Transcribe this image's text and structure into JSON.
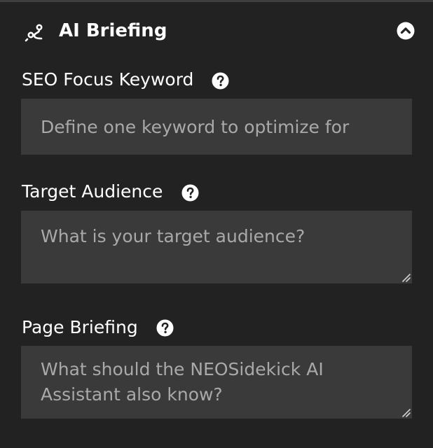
{
  "section": {
    "title": "AI Briefing",
    "icon": "ai-briefing-icon",
    "toggle_icon": "chevron-up-circle-icon"
  },
  "fields": {
    "seo_keyword": {
      "label": "SEO Focus Keyword",
      "value": "",
      "placeholder": "Define one keyword to optimize for",
      "help_icon": "question-circle-icon"
    },
    "target_audience": {
      "label": "Target Audience",
      "value": "",
      "placeholder": "What is your target audience?",
      "help_icon": "question-circle-icon"
    },
    "page_briefing": {
      "label": "Page Briefing",
      "value": "",
      "placeholder": "What should the NEOSidekick AI Assistant also know?",
      "help_icon": "question-circle-icon"
    }
  },
  "colors": {
    "background": "#222222",
    "input_background": "#3a3a3a",
    "placeholder": "#a9a9a9",
    "text": "#ffffff"
  }
}
